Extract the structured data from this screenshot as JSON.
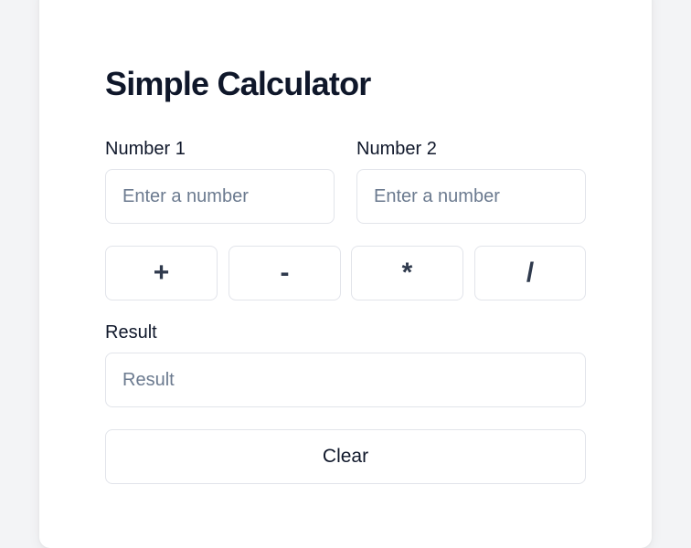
{
  "calculator": {
    "title": "Simple Calculator",
    "number1": {
      "label": "Number 1",
      "placeholder": "Enter a number",
      "value": ""
    },
    "number2": {
      "label": "Number 2",
      "placeholder": "Enter a number",
      "value": ""
    },
    "operations": [
      "+",
      "-",
      "*",
      "/"
    ],
    "result": {
      "label": "Result",
      "placeholder": "Result",
      "value": ""
    },
    "clear_label": "Clear"
  },
  "colors": {
    "page_background": "#f3f4f6",
    "card_background": "#ffffff",
    "border": "#e2e4ea",
    "text": "#0f172a",
    "placeholder": "#6b7a8f",
    "operator_text": "#2f3a4d"
  }
}
